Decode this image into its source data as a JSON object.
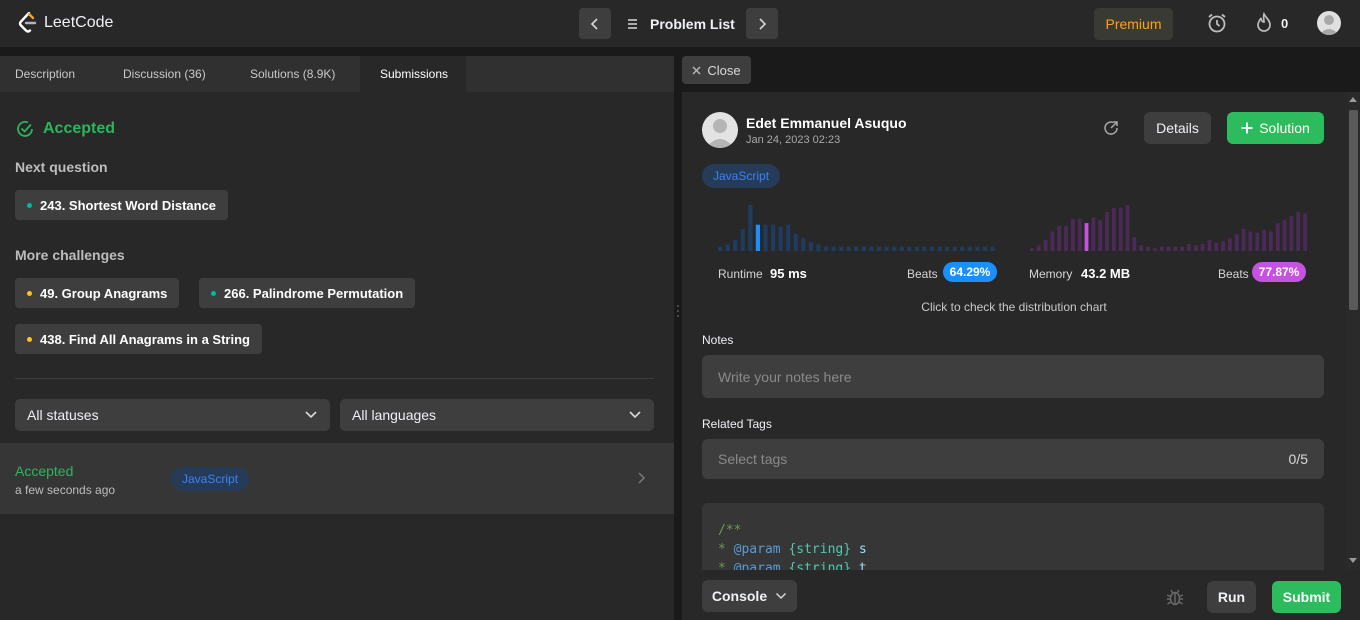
{
  "header": {
    "logo_text": "LeetCode",
    "problem_list_label": "Problem List",
    "premium_label": "Premium",
    "streak_count": "0"
  },
  "left": {
    "tabs": [
      {
        "label": "Description"
      },
      {
        "label": "Discussion (36)"
      },
      {
        "label": "Solutions (8.9K)"
      },
      {
        "label": "Submissions"
      }
    ],
    "accepted_label": "Accepted",
    "next_question_label": "Next question",
    "next_question": {
      "label": "243. Shortest Word Distance",
      "dot_color": "#00b8a3"
    },
    "more_challenges_label": "More challenges",
    "challenges": [
      {
        "label": "49. Group Anagrams",
        "dot_color": "#ffc01e"
      },
      {
        "label": "266. Palindrome Permutation",
        "dot_color": "#00b8a3"
      },
      {
        "label": "438. Find All Anagrams in a String",
        "dot_color": "#ffc01e"
      }
    ],
    "filters": {
      "status": "All statuses",
      "language": "All languages"
    },
    "submission": {
      "status": "Accepted",
      "time": "a few seconds ago",
      "language": "JavaScript"
    }
  },
  "right": {
    "close_label": "Close",
    "author": {
      "name": "Edet Emmanuel Asuquo",
      "date": "Jan 24, 2023 02:23"
    },
    "details_label": "Details",
    "solution_label": "Solution",
    "language_badge": "JavaScript",
    "runtime": {
      "label": "Runtime",
      "value": "95 ms",
      "beats_label": "Beats",
      "beats_value": "64.29%",
      "color": "#1a90ff",
      "histogram": [
        2,
        3,
        5,
        10,
        21,
        12,
        12,
        12,
        11,
        12,
        8,
        6,
        4,
        3,
        2,
        2,
        2,
        2,
        2,
        2,
        2,
        2,
        2,
        2,
        2,
        2,
        2,
        2,
        2,
        2,
        2,
        2,
        2,
        2,
        2,
        2,
        2
      ],
      "highlight_index": 5
    },
    "memory": {
      "label": "Memory",
      "value": "43.2 MB",
      "beats_label": "Beats",
      "beats_value": "77.87%",
      "color": "#c552e1",
      "histogram": [
        2,
        4,
        8,
        14,
        18,
        18,
        23,
        23,
        20,
        24,
        22,
        28,
        31,
        31,
        33,
        10,
        4,
        3,
        2,
        3,
        3,
        3,
        3,
        5,
        4,
        5,
        8,
        6,
        7,
        9,
        12,
        16,
        14,
        13,
        15,
        14,
        20,
        22,
        25,
        28,
        27
      ],
      "highlight_index": 8
    },
    "distribution_hint": "Click to check the distribution chart",
    "notes_label": "Notes",
    "notes_placeholder": "Write your notes here",
    "tags_label": "Related Tags",
    "tags_placeholder": "Select tags",
    "tags_count": "0/5",
    "code_lines": [
      "/**",
      " * @param {string} s",
      " * @param {string} t"
    ]
  },
  "bottom": {
    "console_label": "Console",
    "run_label": "Run",
    "submit_label": "Submit"
  },
  "colors": {
    "accent_green": "#2cbb5d",
    "premium_orange": "#ffa116",
    "easy": "#00b8a3",
    "medium": "#ffc01e"
  }
}
